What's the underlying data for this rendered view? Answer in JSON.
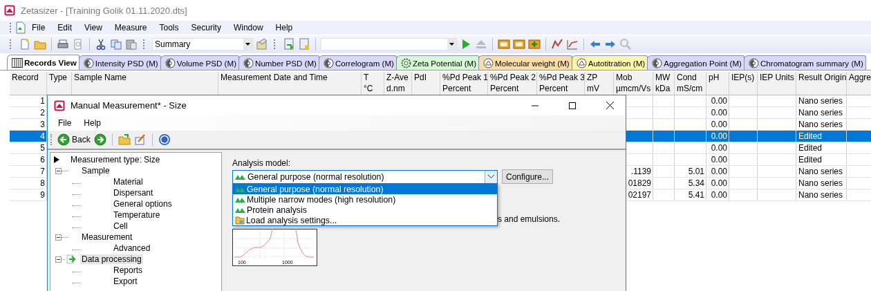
{
  "window": {
    "title": "Zetasizer - [Training Golik 01.11.2020.dts]"
  },
  "menu": [
    "File",
    "Edit",
    "View",
    "Measure",
    "Tools",
    "Security",
    "Window",
    "Help"
  ],
  "toolbar": {
    "view_combo": "Summary"
  },
  "tabs": [
    {
      "label": "Records View",
      "kind": "records",
      "color": "#ffffff",
      "selected": true
    },
    {
      "label": "Intensity PSD (M)",
      "kind": "size",
      "color": "#d8d8f8",
      "selected": false
    },
    {
      "label": "Volume PSD (M)",
      "kind": "size",
      "color": "#d8d8f8",
      "selected": false
    },
    {
      "label": "Number PSD (M)",
      "kind": "size",
      "color": "#d8d8f8",
      "selected": false
    },
    {
      "label": "Correlogram (M)",
      "kind": "size",
      "color": "#d8d8f8",
      "selected": false
    },
    {
      "label": "Zeta Potential (M)",
      "kind": "zeta",
      "color": "#d4f7d4",
      "selected": false
    },
    {
      "label": "Molecular weight (M)",
      "kind": "weight",
      "color": "#f9dca8",
      "selected": false
    },
    {
      "label": "Autotitration (M)",
      "kind": "weight",
      "color": "#fbf7aa",
      "selected": false
    },
    {
      "label": "Aggregation Point (M)",
      "kind": "size",
      "color": "#d8d8f8",
      "selected": false
    },
    {
      "label": "Chromatogram summary (M)",
      "kind": "size",
      "color": "#d8d8f8",
      "selected": false
    }
  ],
  "table": {
    "columns": [
      {
        "name": "Record"
      },
      {
        "name": "Type"
      },
      {
        "name": "Sample Name"
      },
      {
        "name": "Measurement Date and Time"
      },
      {
        "name": "T",
        "unit": "°C"
      },
      {
        "name": "Z-Ave",
        "unit": "d.nm"
      },
      {
        "name": "PdI"
      },
      {
        "name": "%Pd Peak 1",
        "unit": "Percent"
      },
      {
        "name": "%Pd Peak 2",
        "unit": "Percent"
      },
      {
        "name": "%Pd Peak 3",
        "unit": "Percent"
      },
      {
        "name": "ZP",
        "unit": "mV"
      },
      {
        "name": "Mob",
        "unit": "µmcm/Vs"
      },
      {
        "name": "MW",
        "unit": "kDa"
      },
      {
        "name": "Cond",
        "unit": "mS/cm"
      },
      {
        "name": "pH"
      },
      {
        "name": "IEP(s)"
      },
      {
        "name": "IEP Units"
      },
      {
        "name": "Result Origin"
      },
      {
        "name": "Aggre"
      }
    ],
    "rows": [
      {
        "record": "1",
        "ph": "0.00",
        "result_origin": "Nano series",
        "selected": false
      },
      {
        "record": "2",
        "ph": "0.00",
        "result_origin": "Nano series",
        "selected": false
      },
      {
        "record": "3",
        "ph": "0.00",
        "result_origin": "Nano series",
        "selected": false
      },
      {
        "record": "4",
        "ph": "0.00",
        "result_origin": "Edited",
        "selected": true
      },
      {
        "record": "5",
        "ph": "0.00",
        "result_origin": "Edited",
        "selected": false
      },
      {
        "record": "6",
        "ph": "0.00",
        "result_origin": "Edited",
        "selected": false
      },
      {
        "record": "7",
        "mob": ".1139",
        "cond": "5.01",
        "ph": "0.00",
        "result_origin": "Nano series",
        "selected": false
      },
      {
        "record": "8",
        "mob": "01829",
        "cond": "5.34",
        "ph": "0.00",
        "result_origin": "Nano series",
        "selected": false
      },
      {
        "record": "9",
        "mob": "02197",
        "cond": "5.41",
        "ph": "0.00",
        "result_origin": "Nano series",
        "selected": false
      }
    ]
  },
  "dialog": {
    "title": "Manual Measurement* - Size",
    "menu": [
      "File",
      "Help"
    ],
    "toolbar": {
      "back_label": "Back"
    },
    "tree": [
      {
        "label": "Measurement type: Size",
        "expanded": true,
        "selected": false,
        "children": [
          {
            "label": "Sample",
            "expanded": true,
            "selected": false,
            "children": [
              {
                "label": "Material",
                "selected": false
              },
              {
                "label": "Dispersant",
                "selected": false
              },
              {
                "label": "General options",
                "selected": false
              },
              {
                "label": "Temperature",
                "selected": false
              },
              {
                "label": "Cell",
                "selected": false
              }
            ]
          },
          {
            "label": "Measurement",
            "expanded": true,
            "selected": false,
            "children": [
              {
                "label": "Advanced",
                "selected": false
              }
            ]
          },
          {
            "label": "Data processing",
            "expanded": true,
            "selected": true,
            "children": [
              {
                "label": "Reports",
                "selected": false
              },
              {
                "label": "Export",
                "selected": false
              }
            ]
          }
        ]
      }
    ],
    "analysis_label": "Analysis model:",
    "analysis_value": "General purpose (normal resolution)",
    "configure_button": "Configure...",
    "options": [
      {
        "label": "General purpose (normal resolution)",
        "kind": "model",
        "selected": true
      },
      {
        "label": "Multiple narrow modes (high resolution)",
        "kind": "model",
        "selected": false
      },
      {
        "label": "Protein analysis",
        "kind": "model",
        "selected": false
      },
      {
        "label": "Load analysis settings...",
        "kind": "load",
        "selected": false
      }
    ],
    "description_tail": "s and emulsions.",
    "thumbnail": {
      "xtick_labels": [
        "100",
        "1000"
      ]
    }
  }
}
